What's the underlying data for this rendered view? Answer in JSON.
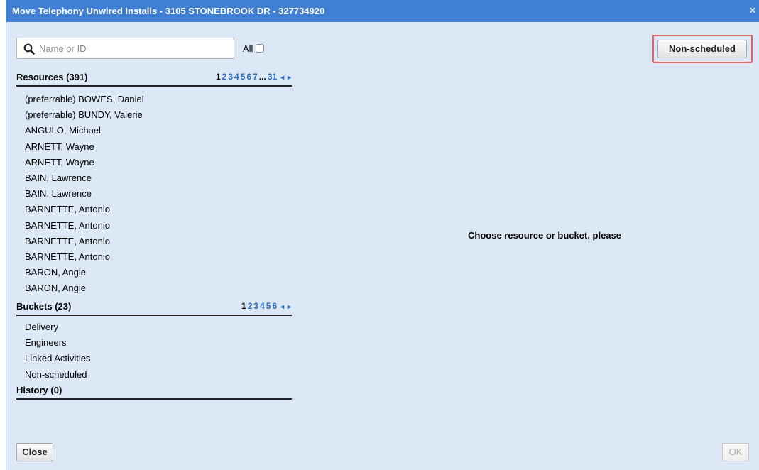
{
  "dialog": {
    "title": "Move Telephony Unwired Installs - 3105 STONEBROOK DR - 327734920",
    "close_glyph": "×"
  },
  "search": {
    "placeholder": "Name or ID",
    "value": "",
    "icon": "search-icon"
  },
  "all_toggle": {
    "label": "All",
    "checked": false
  },
  "non_scheduled_button": {
    "label": "Non-scheduled",
    "highlight_color": "#e06666"
  },
  "resources": {
    "title": "Resources (391)",
    "pager": {
      "current": "1",
      "pages": [
        "2",
        "3",
        "4",
        "5",
        "6",
        "7"
      ],
      "ellipsis": "...",
      "last": "31",
      "arrows": "◂ ▸"
    },
    "items": [
      "(preferrable) BOWES, Daniel",
      "(preferrable) BUNDY, Valerie",
      "ANGULO, Michael",
      "ARNETT, Wayne",
      "ARNETT, Wayne",
      "BAIN, Lawrence",
      "BAIN, Lawrence",
      "BARNETTE, Antonio",
      "BARNETTE, Antonio",
      "BARNETTE, Antonio",
      "BARNETTE, Antonio",
      "BARON, Angie",
      "BARON, Angie"
    ]
  },
  "buckets": {
    "title": "Buckets (23)",
    "pager": {
      "current": "1",
      "pages": [
        "2",
        "3",
        "4",
        "5",
        "6"
      ],
      "arrows": "◂ ▸"
    },
    "items": [
      "Delivery",
      "Engineers",
      "Linked Activities",
      "Non-scheduled"
    ]
  },
  "history": {
    "title": "History (0)"
  },
  "message": "Choose resource or bucket, please",
  "footer": {
    "close_label": "Close",
    "ok_label": "OK"
  },
  "colors": {
    "title_bar": "#3f7fd4",
    "dialog_bg": "#dce8f6",
    "link": "#2f6dbf"
  }
}
